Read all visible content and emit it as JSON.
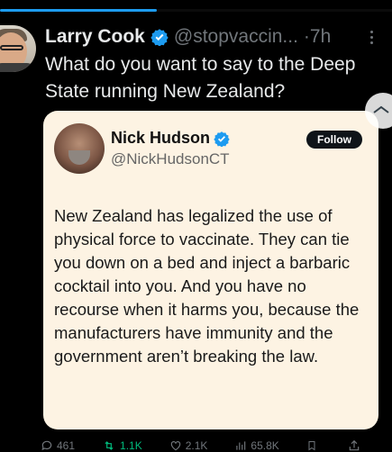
{
  "progress": {
    "fraction": 0.4,
    "color": "#1d9bf0"
  },
  "post": {
    "author_name": "Larry Cook",
    "author_handle": "@stopvaccin...",
    "separator": "·",
    "time": "7h",
    "text": "What do you want to say to the Deep State running New Zealand?"
  },
  "quoted_post": {
    "author_name": "Nick Hudson",
    "author_handle": "@NickHudsonCT",
    "follow_label": "Follow",
    "text": "New Zealand has legalized the use of physical force to vaccinate. They can tie you down on a bed and inject a barbaric cocktail into you. And you have no recourse when it harms you, because the manufacturers have immunity and the government aren’t breaking the law."
  },
  "actions": {
    "replies": "461",
    "reposts": "1.1K",
    "likes": "2.1K",
    "views": "65.8K"
  },
  "colors": {
    "background": "#000000",
    "accent": "#1d9bf0",
    "quote_bg": "#fdf3e3",
    "repost_active": "#00ba7c"
  }
}
